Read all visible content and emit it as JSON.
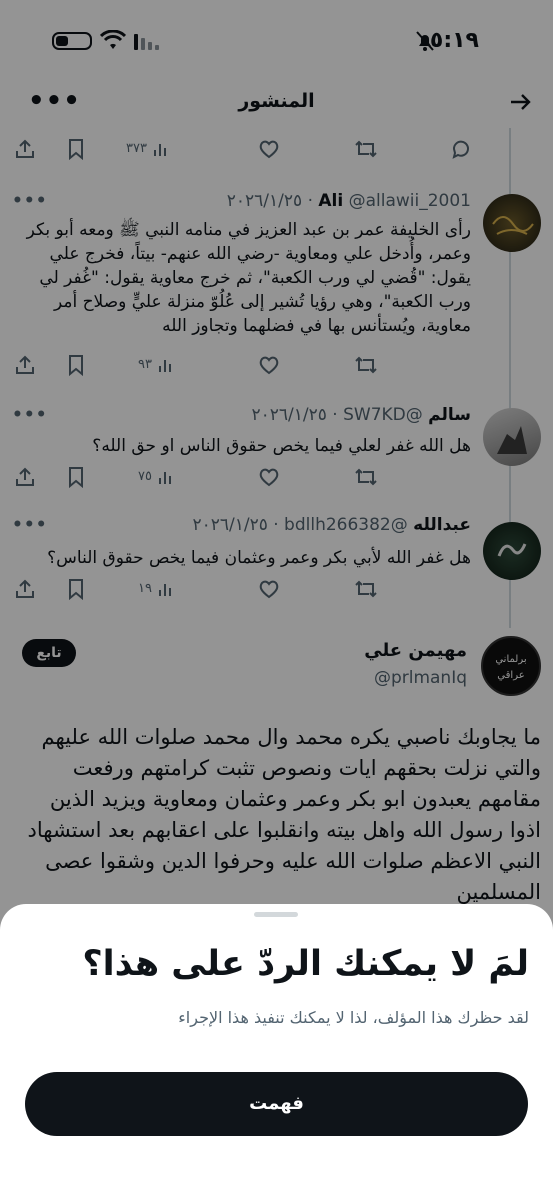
{
  "status_bar": {
    "time": "٥:١٩"
  },
  "header": {
    "title": "المنشور"
  },
  "top_actions": {
    "views": "٣٧٣"
  },
  "replies": [
    {
      "name": "Ali",
      "handle": "@allawii_2001",
      "date": "٢٠٢٦/١/٢٥",
      "text": "رأى الخليفة عمر بن عبد العزيز في منامه النبي ﷺ ومعه أبو بكر وعمر، وأُدخل علي ومعاوية -رضي الله عنهم- بيتاً، فخرج علي يقول: \"قُضي لي ورب الكعبة\"، ثم خرج معاوية يقول: \"غُفر لي ورب الكعبة\"، وهي رؤيا تُشير إلى عُلُوّ منزلة عليٍّ وصلاح أمر معاوية، ويُستأنس بها في فضلهما وتجاوز الله",
      "views": "٩٣"
    },
    {
      "name": "سالم",
      "handle": "@SW7KD",
      "date": "٢٠٢٦/١/٢٥",
      "text": "هل الله غفر لعلي فيما يخص حقوق الناس او حق الله؟",
      "views": "٧٥"
    },
    {
      "name": "عبدالله",
      "handle": "@bdllh266382",
      "date": "٢٠٢٦/١/٢٥",
      "text": "هل غفر الله لأبي بكر وعمر وعثمان فيما يخص حقوق الناس؟",
      "views": "١٩"
    }
  ],
  "main_post": {
    "name": "مهيمن علي",
    "handle": "@prlmanIq",
    "avatar_text": "برلماني عراقي",
    "follow_label": "تابع",
    "text": "ما يجاوبك ناصبي يكره محمد وال محمد صلوات الله عليهم والتي نزلت بحقهم ايات ونصوص تثبت كرامتهم ورفعت مقامهم يعبدون ابو بكر وعمر وعثمان ومعاوية ويزيد الذين اذوا رسول الله واهل بيته وانقلبوا على اعقابهم بعد استشهاد النبي الاعظم صلوات الله عليه وحرفوا الدين وشقوا عصى المسلمين"
  },
  "sheet": {
    "title": "لمَ لا يمكنك الردّ على هذا؟",
    "subtitle": "لقد حظرك هذا المؤلف، لذا لا يمكنك تنفيذ هذا الإجراء",
    "button": "فهمت"
  }
}
